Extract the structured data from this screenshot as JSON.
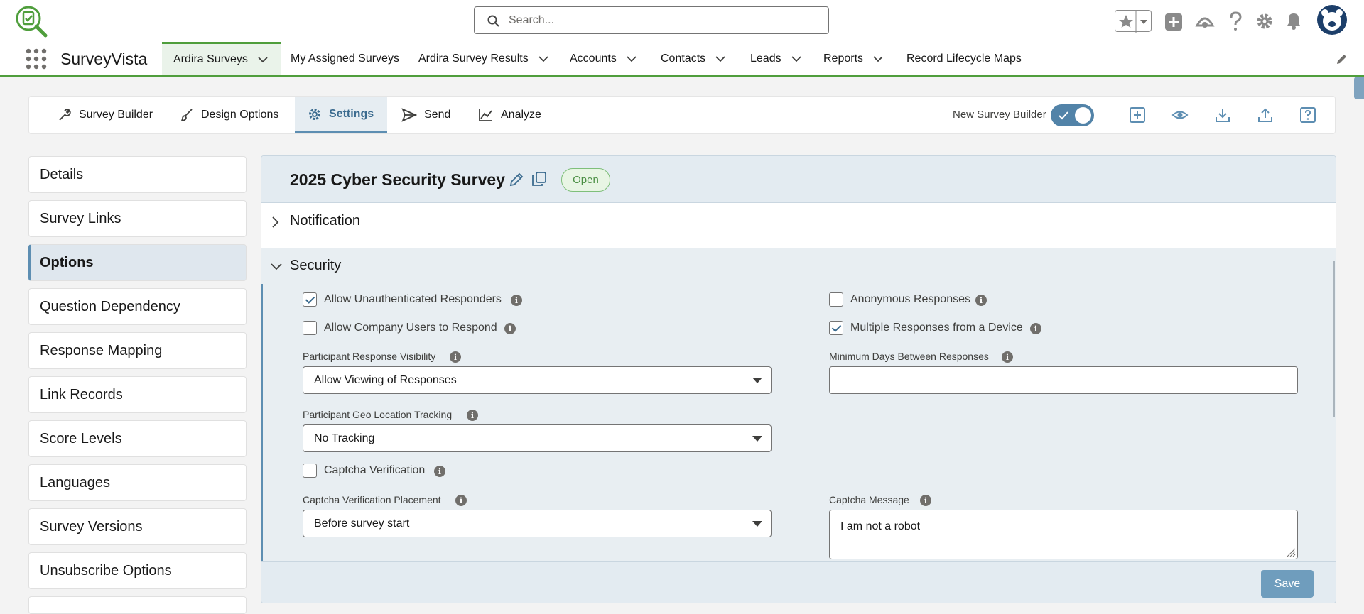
{
  "header": {
    "search_placeholder": "Search..."
  },
  "nav": {
    "app_name": "SurveyVista",
    "tabs": [
      {
        "label": "Ardira Surveys"
      },
      {
        "label": "My Assigned Surveys"
      },
      {
        "label": "Ardira Survey Results"
      },
      {
        "label": "Accounts"
      },
      {
        "label": "Contacts"
      },
      {
        "label": "Leads"
      },
      {
        "label": "Reports"
      },
      {
        "label": "Record Lifecycle Maps"
      }
    ]
  },
  "toolbar": {
    "tabs": [
      {
        "label": "Survey Builder"
      },
      {
        "label": "Design Options"
      },
      {
        "label": "Settings"
      },
      {
        "label": "Send"
      },
      {
        "label": "Analyze"
      }
    ],
    "new_builder_label": "New Survey Builder",
    "new_builder_on": true
  },
  "sidebar": {
    "items": [
      {
        "label": "Details"
      },
      {
        "label": "Survey Links"
      },
      {
        "label": "Options"
      },
      {
        "label": "Question Dependency"
      },
      {
        "label": "Response Mapping"
      },
      {
        "label": "Link Records"
      },
      {
        "label": "Score Levels"
      },
      {
        "label": "Languages"
      },
      {
        "label": "Survey Versions"
      },
      {
        "label": "Unsubscribe Options"
      }
    ],
    "active": "Options"
  },
  "survey": {
    "title": "2025 Cyber Security Survey",
    "status": "Open"
  },
  "sections": {
    "notification": "Notification",
    "security": "Security"
  },
  "security": {
    "allow_unauth": {
      "label": "Allow Unauthenticated Responders",
      "checked": true
    },
    "anonymous": {
      "label": "Anonymous Responses",
      "checked": false
    },
    "company_users": {
      "label": "Allow Company Users to Respond",
      "checked": false
    },
    "multiple_device": {
      "label": "Multiple Responses from a Device",
      "checked": true
    },
    "visibility": {
      "label": "Participant Response Visibility",
      "value": "Allow Viewing of Responses"
    },
    "min_days": {
      "label": "Minimum Days Between Responses",
      "value": ""
    },
    "geo": {
      "label": "Participant Geo Location Tracking",
      "value": "No Tracking"
    },
    "captcha": {
      "label": "Captcha Verification",
      "checked": false
    },
    "captcha_placement": {
      "label": "Captcha Verification Placement",
      "value": "Before survey start"
    },
    "captcha_message": {
      "label": "Captcha Message",
      "value": "I am not a robot"
    }
  },
  "footer": {
    "save_label": "Save"
  },
  "colors": {
    "accent_green": "#4f9e3c",
    "accent_blue": "#5d8eb2",
    "save_blue": "#6f9dbd"
  }
}
